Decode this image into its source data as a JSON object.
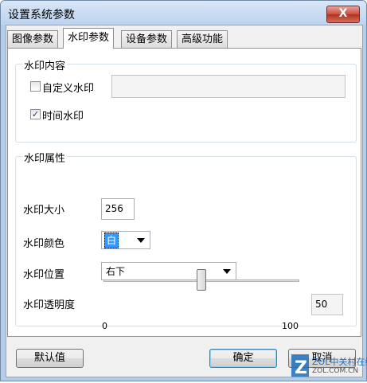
{
  "window": {
    "title": "设置系统参数",
    "close_label": "X"
  },
  "tabs": [
    {
      "label": "图像参数"
    },
    {
      "label": "水印参数"
    },
    {
      "label": "设备参数"
    },
    {
      "label": "高级功能"
    }
  ],
  "content_group": {
    "title": "水印内容",
    "custom_watermark": {
      "label": "自定义水印",
      "checked": false,
      "value": ""
    },
    "time_watermark": {
      "label": "时间水印",
      "checked": true
    }
  },
  "attribute_group": {
    "title": "水印属性",
    "size": {
      "label": "水印大小",
      "value": "256"
    },
    "color": {
      "label": "水印颜色",
      "value": "白"
    },
    "position": {
      "label": "水印位置",
      "value": "右下"
    },
    "transparency": {
      "label": "水印透明度",
      "value": "50",
      "min": "0",
      "max": "100",
      "level": 50
    }
  },
  "buttons": {
    "default": "默认值",
    "ok": "确定",
    "cancel": "取消"
  },
  "corner_logo": {
    "text": "ZOL中关村在线",
    "url_text": "ZOL.COM.CN"
  }
}
